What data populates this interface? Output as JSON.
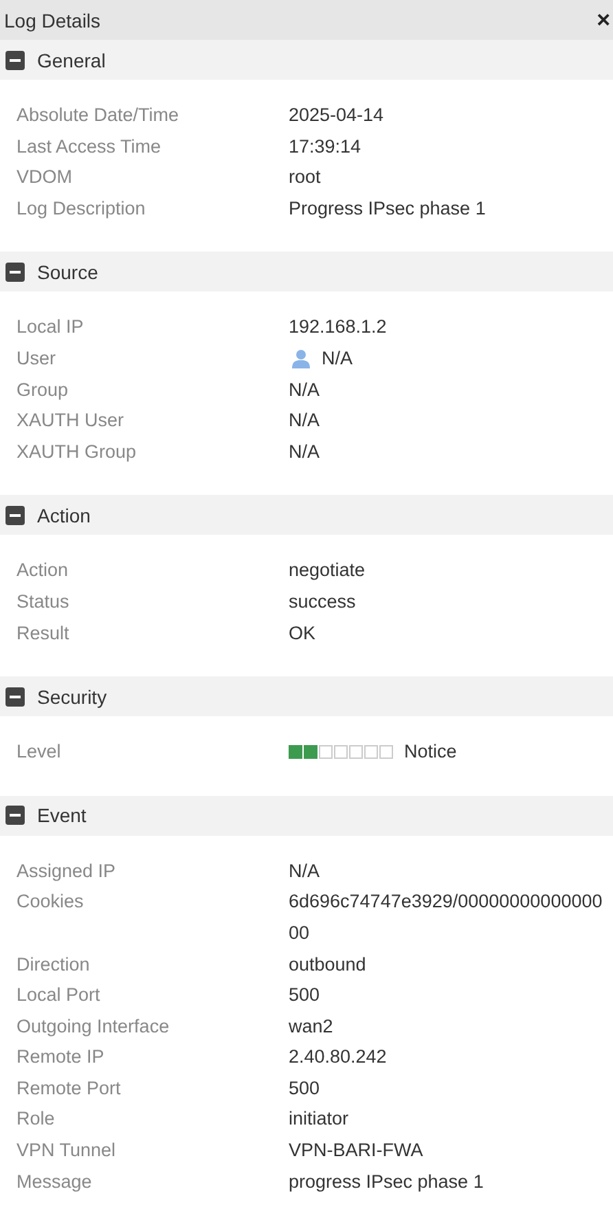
{
  "window": {
    "title": "Log Details",
    "close": "×"
  },
  "sections": [
    {
      "title": "General",
      "expanded": true,
      "rows": [
        {
          "kind": "text",
          "label": "Absolute Date/Time",
          "value": "2025-04-14"
        },
        {
          "kind": "text",
          "label": "Last Access Time",
          "value": "17:39:14"
        },
        {
          "kind": "text",
          "label": "VDOM",
          "value": "root"
        },
        {
          "kind": "text",
          "label": "Log Description",
          "value": "Progress IPsec phase 1"
        }
      ]
    },
    {
      "title": "Source",
      "expanded": true,
      "rows": [
        {
          "kind": "text",
          "label": "Local IP",
          "value": "192.168.1.2"
        },
        {
          "kind": "user",
          "label": "User",
          "value": "N/A"
        },
        {
          "kind": "text",
          "label": "Group",
          "value": "N/A"
        },
        {
          "kind": "text",
          "label": "XAUTH User",
          "value": "N/A"
        },
        {
          "kind": "text",
          "label": "XAUTH Group",
          "value": "N/A"
        }
      ]
    },
    {
      "title": "Action",
      "expanded": true,
      "rows": [
        {
          "kind": "text",
          "label": "Action",
          "value": "negotiate"
        },
        {
          "kind": "text",
          "label": "Status",
          "value": "success"
        },
        {
          "kind": "text",
          "label": "Result",
          "value": "OK"
        }
      ]
    },
    {
      "title": "Security",
      "expanded": true,
      "rows": [
        {
          "kind": "level",
          "label": "Level",
          "value": "Notice",
          "level": 0.2857
        }
      ]
    },
    {
      "title": "Event",
      "expanded": true,
      "rows": [
        {
          "kind": "text",
          "label": "Assigned IP",
          "value": "N/A"
        },
        {
          "kind": "text",
          "label": "Cookies",
          "value": "6d696c74747e3929/0000000000000000"
        },
        {
          "kind": "text",
          "label": "Direction",
          "value": "outbound"
        },
        {
          "kind": "text",
          "label": "Local Port",
          "value": "500"
        },
        {
          "kind": "text",
          "label": "Outgoing Interface",
          "value": "wan2"
        },
        {
          "kind": "text",
          "label": "Remote IP",
          "value": "2.40.80.242"
        },
        {
          "kind": "text",
          "label": "Remote Port",
          "value": "500"
        },
        {
          "kind": "text",
          "label": "Role",
          "value": "initiator"
        },
        {
          "kind": "text",
          "label": "VPN Tunnel",
          "value": "VPN-BARI-FWA"
        },
        {
          "kind": "text",
          "label": "Message",
          "value": "progress IPsec phase 1"
        }
      ]
    }
  ]
}
